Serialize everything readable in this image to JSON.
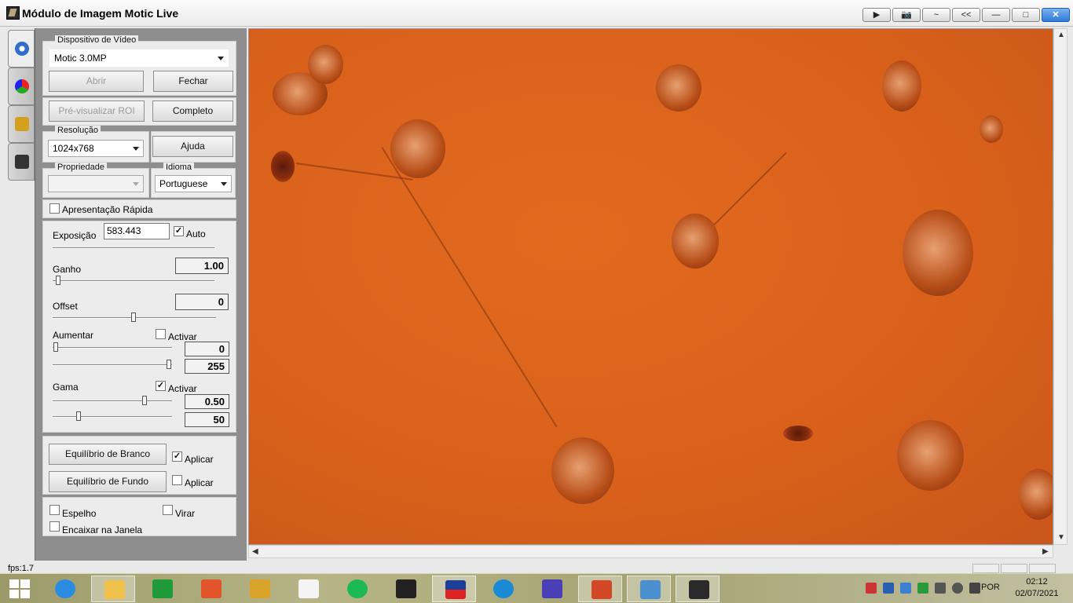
{
  "window": {
    "title": "Módulo de Imagem Motic Live",
    "controls": [
      "▶",
      "📷",
      "~",
      "<<",
      "—",
      "□",
      "✕"
    ]
  },
  "panel": {
    "video_device": {
      "group_label": "Dispositivo de Vídeo",
      "device": "Motic 3.0MP",
      "open_label": "Abrir",
      "close_label": "Fechar"
    },
    "preview_roi_label": "Pré-visualizar ROI",
    "full_label": "Completo",
    "resolution": {
      "group_label": "Resolução",
      "value": "1024x768"
    },
    "help_label": "Ajuda",
    "property": {
      "group_label": "Propriedade",
      "value": ""
    },
    "language": {
      "group_label": "Idioma",
      "value": "Portuguese"
    },
    "quick_preview_label": "Apresentação Rápida",
    "exposure": {
      "label": "Exposição",
      "value": "583.443",
      "auto_label": "Auto",
      "auto_checked": true
    },
    "gain": {
      "label": "Ganho",
      "value": "1.00",
      "slider_fraction": 0.02
    },
    "offset": {
      "label": "Offset",
      "value": "0",
      "slider_fraction": 0.5
    },
    "enhance": {
      "label": "Aumentar",
      "activate_label": "Activar",
      "activate_checked": false,
      "low": "0",
      "high": "255"
    },
    "gamma": {
      "label": "Gama",
      "activate_label": "Activar",
      "activate_checked": true,
      "value1": "0.50",
      "value2": "50"
    },
    "white_balance": {
      "button_label": "Equilíbrio de Branco",
      "apply_label": "Aplicar",
      "apply_checked": true
    },
    "background_balance": {
      "button_label": "Equilíbrio de Fundo",
      "apply_label": "Aplicar",
      "apply_checked": false
    },
    "mirror_label": "Espelho",
    "flip_label": "Virar",
    "fit_window_label": "Encaixar na Janela"
  },
  "status": {
    "fps": "fps:1.7"
  },
  "taskbar": {
    "language": "POR",
    "time": "02:12",
    "date": "02/07/2021",
    "apps": [
      "internet-explorer",
      "file-explorer",
      "store",
      "photos",
      "notes",
      "home",
      "spotify",
      "amazon",
      "motic",
      "edge",
      "settings",
      "powerpoint",
      "photo-viewer",
      "motic-live"
    ]
  }
}
